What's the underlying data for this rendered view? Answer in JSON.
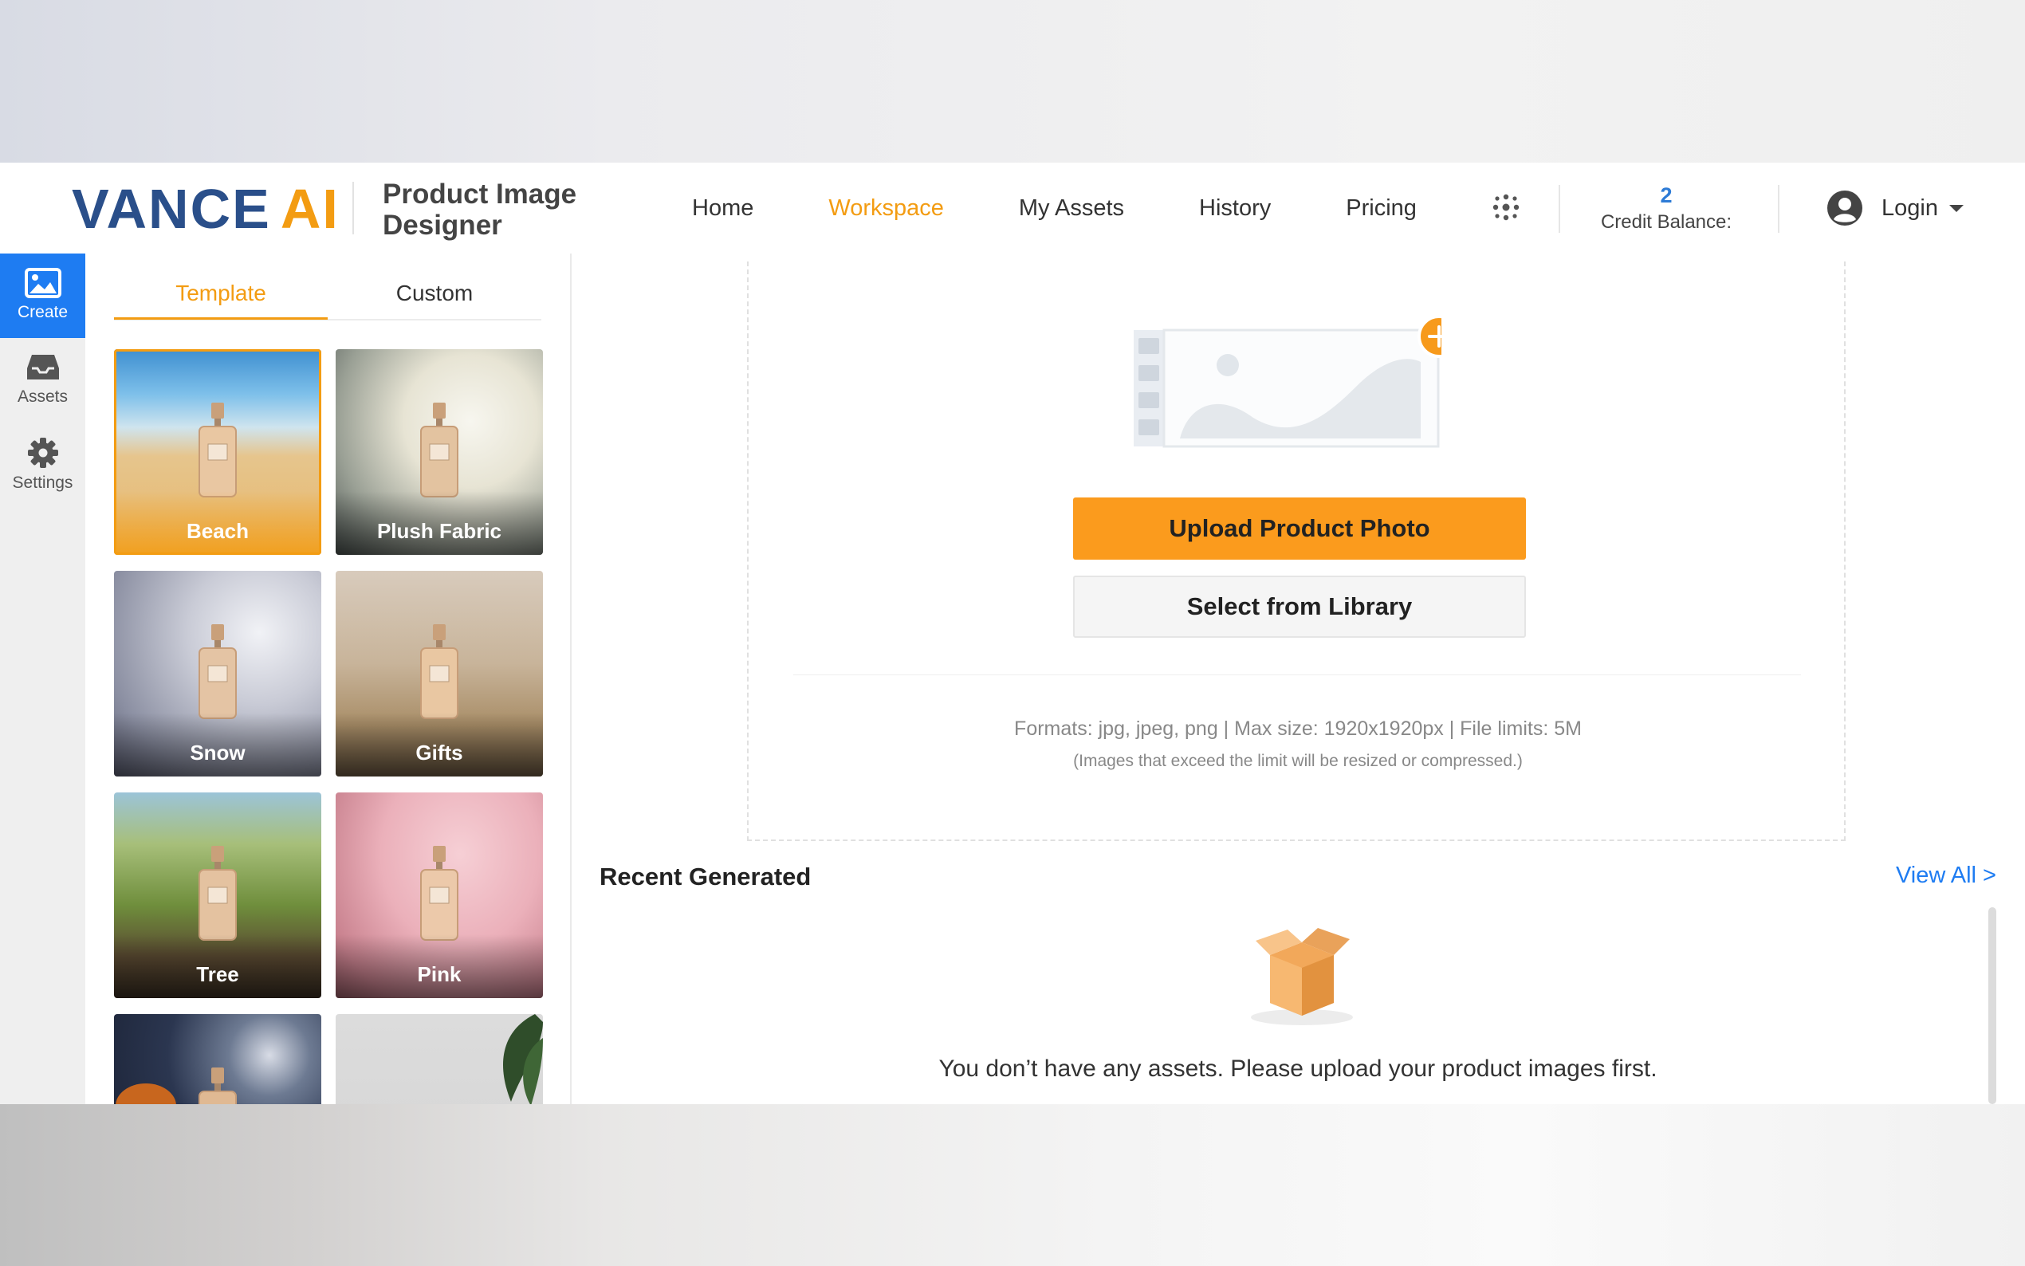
{
  "header": {
    "logo_part1": "VANCE",
    "logo_part2": "AI",
    "product_title": "Product Image Designer",
    "nav": [
      {
        "label": "Home",
        "active": false
      },
      {
        "label": "Workspace",
        "active": true
      },
      {
        "label": "My Assets",
        "active": false
      },
      {
        "label": "History",
        "active": false
      },
      {
        "label": "Pricing",
        "active": false
      }
    ],
    "apps_icon": "apps-grid-icon",
    "credit_value": "2",
    "credit_label": "Credit Balance:",
    "login_label": "Login"
  },
  "rail": {
    "items": [
      {
        "label": "Create",
        "icon": "image-icon",
        "active": true
      },
      {
        "label": "Assets",
        "icon": "inbox-icon",
        "active": false
      },
      {
        "label": "Settings",
        "icon": "gear-icon",
        "active": false
      }
    ]
  },
  "panel": {
    "tabs": [
      {
        "label": "Template",
        "active": true
      },
      {
        "label": "Custom",
        "active": false
      }
    ],
    "templates": [
      {
        "name": "Beach",
        "selected": true
      },
      {
        "name": "Plush Fabric",
        "selected": false
      },
      {
        "name": "Snow",
        "selected": false
      },
      {
        "name": "Gifts",
        "selected": false
      },
      {
        "name": "Tree",
        "selected": false
      },
      {
        "name": "Pink",
        "selected": false
      },
      {
        "name": "",
        "selected": false
      },
      {
        "name": "",
        "selected": false
      }
    ]
  },
  "upload": {
    "upload_button": "Upload Product Photo",
    "library_button": "Select from Library",
    "formats": "Formats: jpg, jpeg, png | Max size: 1920x1920px | File limits: 5M",
    "formats_note": "(Images that exceed the limit will be resized or compressed.)"
  },
  "recent": {
    "title": "Recent Generated",
    "view_all": "View All >",
    "empty_message": "You don’t have any assets. Please upload your product images first."
  },
  "colors": {
    "accent": "#f39c12",
    "upload_button": "#fb9b1d",
    "primary_blue": "#1e7cf2",
    "logo_blue": "#2a4f8a"
  }
}
